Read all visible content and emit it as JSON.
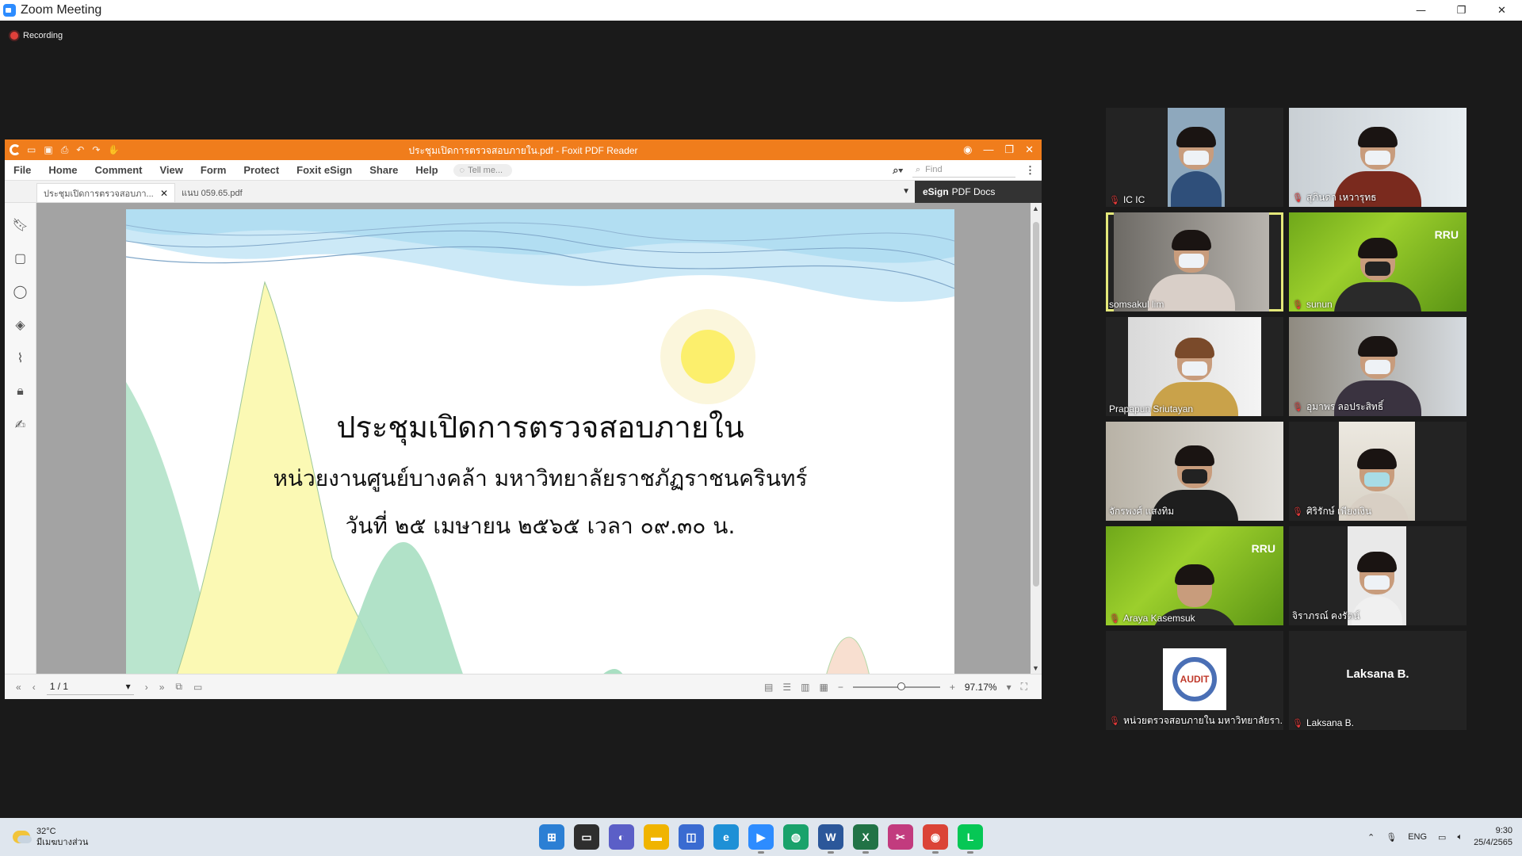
{
  "window": {
    "title": "Zoom Meeting",
    "minimize": "—",
    "maximize": "❐",
    "close": "✕"
  },
  "recording": {
    "label": "Recording"
  },
  "foxit": {
    "doc_title": "ประชุมเปิดการตรวจสอบภายใน.pdf - Foxit PDF Reader",
    "menu": [
      "File",
      "Home",
      "Comment",
      "View",
      "Form",
      "Protect",
      "Foxit eSign",
      "Share",
      "Help"
    ],
    "tell_me": "Tell me...",
    "find_placeholder": "Find",
    "tabs": [
      {
        "label": "ประชุมเปิดการตรวจสอบภา..."
      },
      {
        "label": "แนบ 059.65.pdf"
      }
    ],
    "esign": {
      "bold": "eSign",
      "rest": "PDF Docs"
    },
    "page": {
      "line1": "ประชุมเปิดการตรวจสอบภายใน",
      "line2": "หน่วยงานศูนย์บางคล้า มหาวิทยาลัยราชภัฏราชนครินทร์",
      "line3": "วันที่ ๒๕ เมษายน ๒๕๖๕ เวลา ๐๙.๓๐ น."
    },
    "status": {
      "page_indicator": "1 / 1",
      "zoom": "97.17%"
    }
  },
  "participants": [
    {
      "name": "IC IC",
      "muted": true
    },
    {
      "name": "สุภินดา  เหวารุทธ",
      "muted": true
    },
    {
      "name": "somsakul lim",
      "muted": false,
      "speaking": true
    },
    {
      "name": "sunun",
      "muted": true
    },
    {
      "name": "Prapapun Sriutayan",
      "muted": false
    },
    {
      "name": "อุมาพร ลอประสิทธิ์",
      "muted": true
    },
    {
      "name": "จักรพงศ์  แสงทิม",
      "muted": false
    },
    {
      "name": "ศิริรักษ์ เพียงเงิน",
      "muted": true
    },
    {
      "name": "Araya  Kasemsuk",
      "muted": true
    },
    {
      "name": "จิราภรณ์ คงรัตน์",
      "muted": false
    },
    {
      "name": "หน่วยตรวจสอบภายใน มหาวิทยาลัยรา...",
      "muted": true
    },
    {
      "name": "Laksana B.",
      "muted": true,
      "display_label": "Laksana B."
    }
  ],
  "taskbar": {
    "temp": "32°C",
    "weather": "มีเมฆบางส่วน",
    "lang": "ENG",
    "time": "9:30",
    "date": "25/4/2565"
  }
}
